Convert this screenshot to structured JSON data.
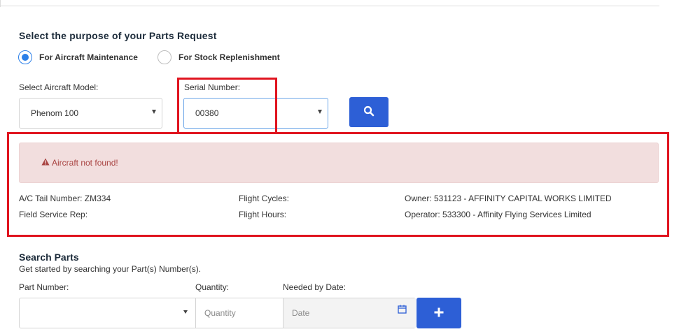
{
  "purpose": {
    "title": "Select the purpose of your Parts Request",
    "options": [
      {
        "label": "For Aircraft Maintenance",
        "selected": true
      },
      {
        "label": "For Stock Replenishment",
        "selected": false
      }
    ]
  },
  "aircraft": {
    "model_label": "Select Aircraft Model:",
    "model_value": "Phenom 100",
    "serial_label": "Serial Number:",
    "serial_value": "00380",
    "search_icon": "search-icon"
  },
  "alert": {
    "icon": "warning-icon",
    "message": "Aircraft not found!"
  },
  "details": {
    "tail_number": "A/C Tail Number: ZM334",
    "field_service_rep": "Field Service Rep:",
    "flight_cycles": "Flight Cycles:",
    "flight_hours": "Flight Hours:",
    "owner": "Owner: 531123 - AFFINITY CAPITAL WORKS LIMITED",
    "operator": "Operator: 533300 - Affinity Flying Services Limited"
  },
  "search_parts": {
    "title": "Search Parts",
    "subtitle": "Get started by searching your Part(s) Number(s).",
    "part_number_label": "Part Number:",
    "quantity_label": "Quantity:",
    "needed_by_label": "Needed by Date:",
    "part_number_value": "",
    "quantity_placeholder": "Quantity",
    "date_placeholder": "Date",
    "calendar_icon": "calendar-icon",
    "add_icon": "plus-icon"
  },
  "colors": {
    "primary": "#2d5fd6",
    "radio_accent": "#2b7fe8",
    "alert_bg": "#f2dede",
    "alert_text": "#a94442",
    "highlight": "#e0141f"
  }
}
